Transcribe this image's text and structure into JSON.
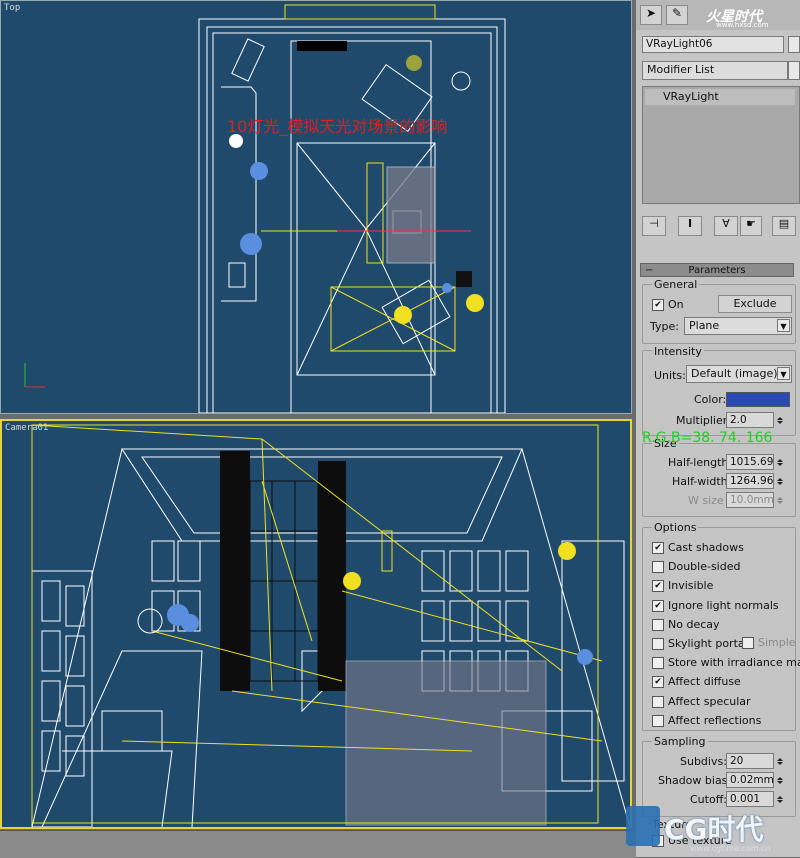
{
  "viewports": {
    "top_label": "Top",
    "camera_label": "Camera01",
    "annotation": "10灯光_模拟天光对场景的影响",
    "rgb_readout": "R.G.B=38. 74. 166"
  },
  "panel": {
    "object_name": "VRayLight06",
    "modifier_list": "Modifier List",
    "stack_item": "VRayLight",
    "rollout_title": "Parameters",
    "general": {
      "title": "General",
      "on_label": "On",
      "on_checked": true,
      "exclude_label": "Exclude",
      "type_label": "Type:",
      "type_value": "Plane"
    },
    "intensity": {
      "title": "Intensity",
      "units_label": "Units:",
      "units_value": "Default (image)",
      "color_label": "Color:",
      "color_swatch": "#2a4ab3",
      "multiplier_label": "Multiplier:",
      "multiplier_value": "2.0"
    },
    "size": {
      "title": "Size",
      "half_length_label": "Half-length:",
      "half_length_value": "1015.696",
      "half_width_label": "Half-width:",
      "half_width_value": "1264.969",
      "w_size_label": "W size",
      "w_size_value": "10.0mm"
    },
    "options": {
      "title": "Options",
      "items": [
        {
          "label": "Cast shadows",
          "checked": true
        },
        {
          "label": "Double-sided",
          "checked": false
        },
        {
          "label": "Invisible",
          "checked": true
        },
        {
          "label": "Ignore light normals",
          "checked": true
        },
        {
          "label": "No decay",
          "checked": false
        },
        {
          "label": "Skylight portal",
          "checked": false
        },
        {
          "label": "Store with irradiance map",
          "checked": false
        },
        {
          "label": "Affect diffuse",
          "checked": true
        },
        {
          "label": "Affect specular",
          "checked": false
        },
        {
          "label": "Affect reflections",
          "checked": false
        }
      ],
      "simple_label": "Simple"
    },
    "sampling": {
      "title": "Sampling",
      "subdivs_label": "Subdivs:",
      "subdivs_value": "20",
      "shadow_bias_label": "Shadow bias:",
      "shadow_bias_value": "0.02mm",
      "cutoff_label": "Cutoff:",
      "cutoff_value": "0.001"
    },
    "texture_label": "Texture",
    "use_texture_label": "Use texture"
  },
  "watermarks": {
    "top_brand": "火星时代",
    "top_url": "www.hxsd.com",
    "bottom_brand": "CG时代",
    "bottom_url": "www.cgtime.com.cn"
  },
  "colors": {
    "viewport_bg": "#1f4a6c",
    "wire_white": "#ffffff",
    "wire_yellow": "#f0e020",
    "annotation_red": "#e02020",
    "readout_green": "#20d020"
  }
}
